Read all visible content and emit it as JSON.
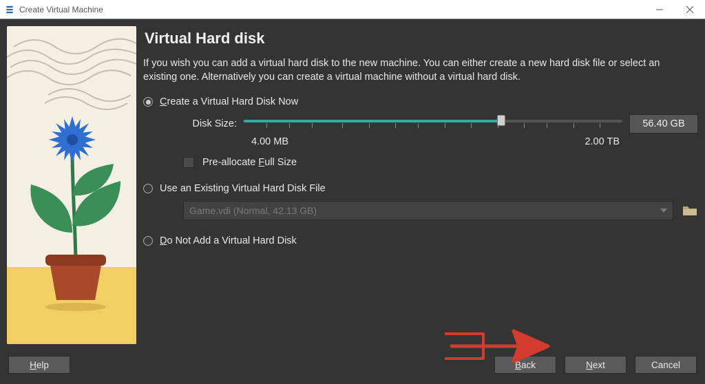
{
  "window": {
    "title": "Create Virtual Machine"
  },
  "page": {
    "heading": "Virtual Hard disk",
    "description": "If you wish you can add a virtual hard disk to the new machine. You can either create a new hard disk file or select an existing one. Alternatively you can create a virtual machine without a virtual hard disk."
  },
  "options": {
    "create": {
      "prefix_ul": "C",
      "rest": "reate a Virtual Hard Disk Now"
    },
    "existing": {
      "label": "Use an Existing Virtual Hard Disk File"
    },
    "none": {
      "prefix_ul": "D",
      "rest": "o Not Add a Virtual Hard Disk"
    }
  },
  "disk": {
    "size_label": "Disk Size:",
    "min_label": "4.00 MB",
    "max_label": "2.00 TB",
    "value_label": "56.40 GB",
    "prealloc_prefix": "Pre-allocate ",
    "prealloc_ul": "F",
    "prealloc_rest": "ull Size"
  },
  "existing_file": {
    "display": "Game.vdi (Normal, 42.13 GB)"
  },
  "buttons": {
    "help_ul": "H",
    "help_rest": "elp",
    "back_ul": "B",
    "back_rest": "ack",
    "next_ul": "N",
    "next_rest": "ext",
    "cancel": "Cancel"
  }
}
